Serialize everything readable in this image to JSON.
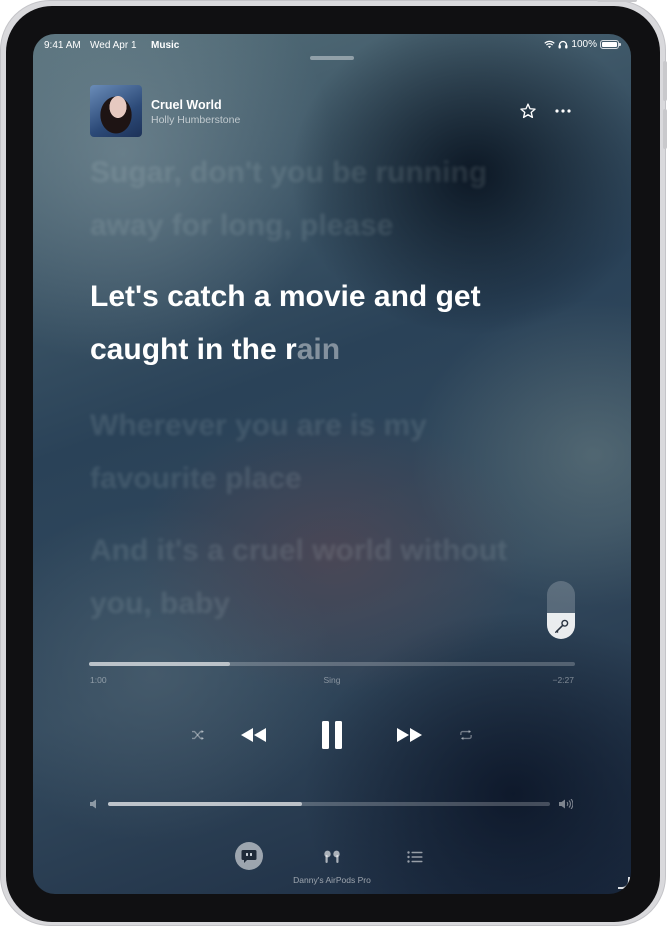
{
  "status_bar": {
    "time": "9:41 AM",
    "date": "Wed Apr 1",
    "app_name": "Music",
    "battery": "100%"
  },
  "now_playing": {
    "title": "Cruel World",
    "artist": "Holly Humberstone"
  },
  "lyrics": [
    {
      "line1": "Sugar, don't you be running",
      "line2": "away for long, please",
      "state": "past"
    },
    {
      "line1": "Let's catch a movie and get",
      "line2_sung": "caught in the r",
      "line2_pending": "ain",
      "state": "current"
    },
    {
      "line1": "Wherever you are is my",
      "line2": "favourite place",
      "state": "upcoming"
    },
    {
      "line1": "And it's a cruel world without",
      "line2": "you, baby",
      "state": "upcoming"
    }
  ],
  "playback": {
    "elapsed": "1:00",
    "mode_label": "Sing",
    "remaining": "−2:27",
    "progress_fraction": 0.29,
    "volume_fraction": 0.44,
    "is_playing": true
  },
  "output_device": {
    "name": "Danny's AirPods Pro"
  },
  "icons": {
    "favorite": "star-icon",
    "more": "ellipsis-icon",
    "sing": "microphone-icon",
    "shuffle": "shuffle-icon",
    "previous": "backward-icon",
    "pause": "pause-icon",
    "next": "forward-icon",
    "repeat": "repeat-icon",
    "volume_low": "speaker-low-icon",
    "volume_high": "speaker-high-icon",
    "lyrics": "lyrics-quote-icon",
    "airplay": "airpods-icon",
    "queue": "list-icon"
  }
}
